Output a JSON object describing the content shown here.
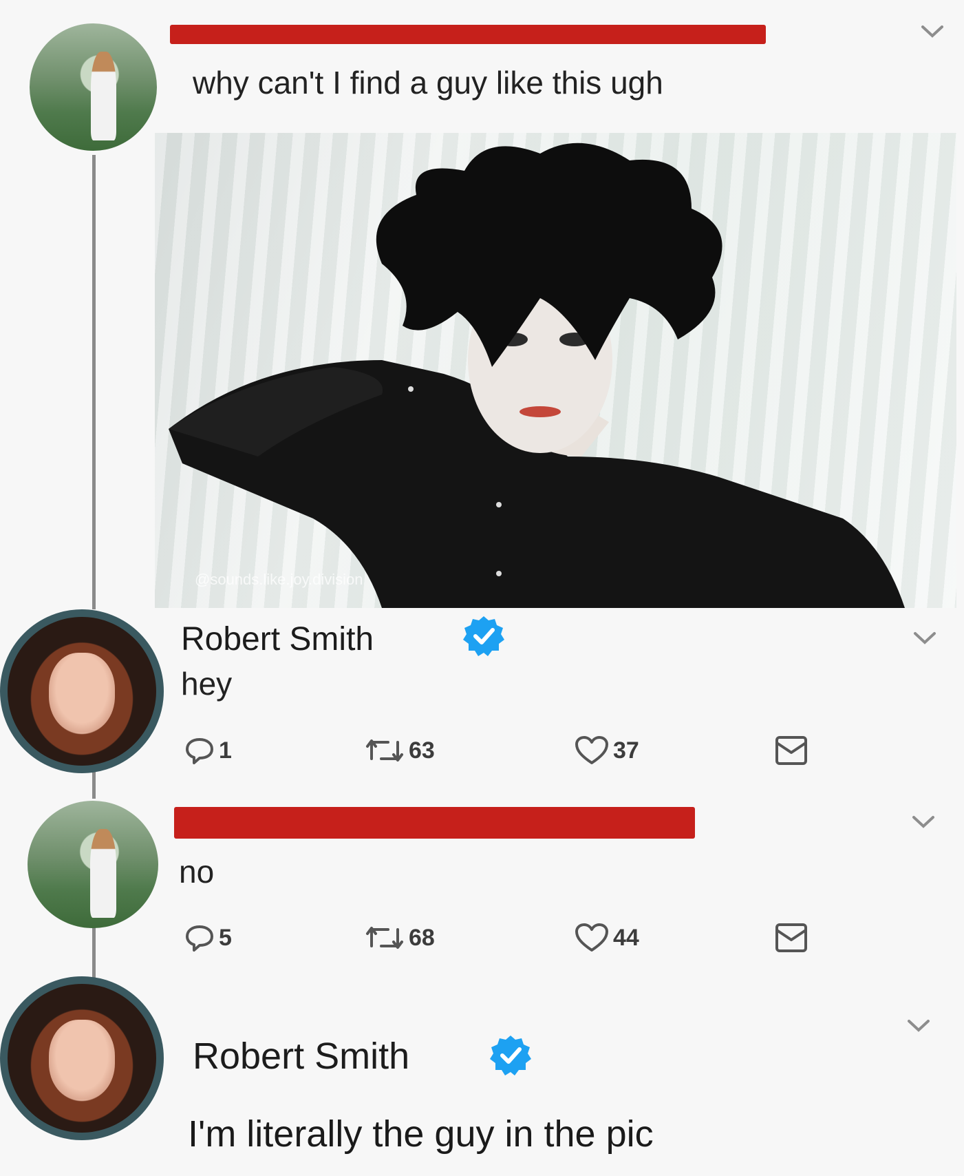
{
  "tweets": [
    {
      "text": "why can't I find a guy like this ugh",
      "media": {
        "watermark": "@sounds.like.joy.division"
      }
    },
    {
      "author": "Robert Smith",
      "text": "hey",
      "stats": {
        "replies": "1",
        "retweets": "63",
        "likes": "37"
      }
    },
    {
      "text": "no",
      "stats": {
        "replies": "5",
        "retweets": "68",
        "likes": "44"
      }
    },
    {
      "author": "Robert Smith",
      "text": "I'm literally the guy in the pic"
    }
  ],
  "colors": {
    "redaction": "#c6201b",
    "verified": "#1da1f2",
    "avatar_ring": "#3a5960"
  },
  "icons": [
    "reply-icon",
    "retweet-icon",
    "like-icon",
    "dm-icon",
    "chevron-down-icon",
    "verified-badge-icon"
  ]
}
